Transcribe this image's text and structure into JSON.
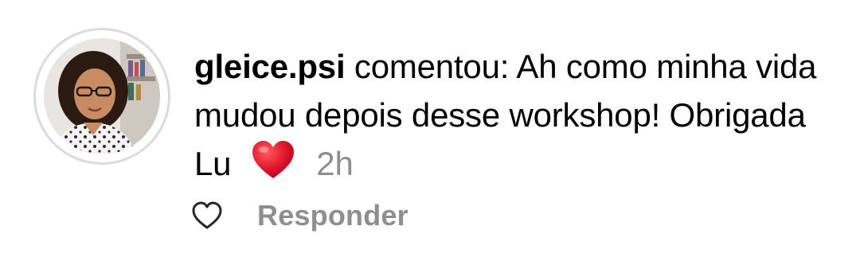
{
  "comment": {
    "username": "gleice.psi",
    "verb": "comentou:",
    "text": "Ah como minha vida mudou depois desse workshop! Obrigada Lu",
    "emoji": "heart-emoji",
    "timestamp": "2h",
    "avatar_icon": "profile-photo"
  },
  "actions": {
    "like_icon": "heart-outline-icon",
    "reply_label": "Responder"
  },
  "colors": {
    "secondary_text": "#8e8e8e",
    "heart_red": "#e0162b",
    "avatar_ring": "#dbdbdb"
  }
}
